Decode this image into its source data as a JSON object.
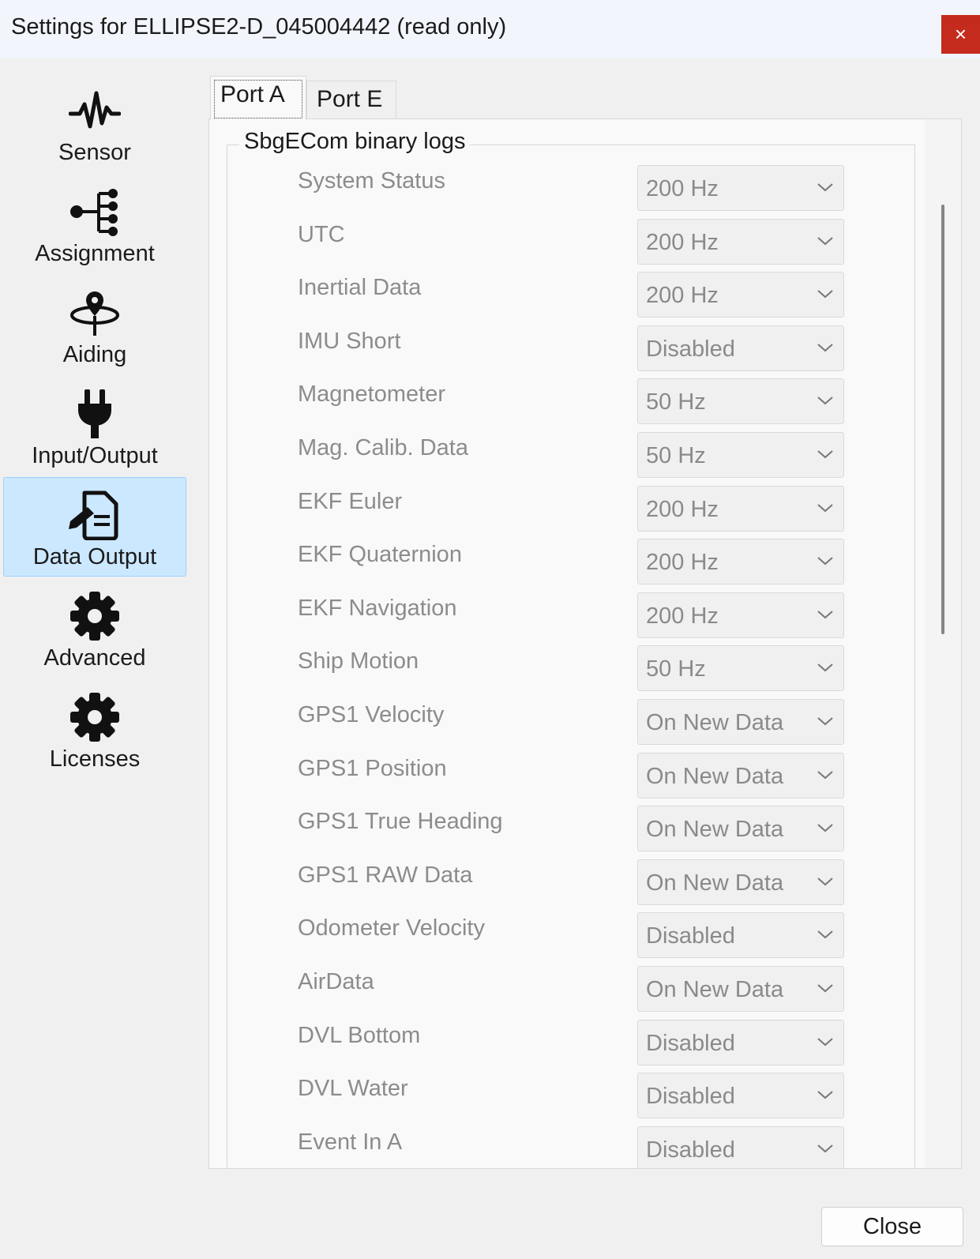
{
  "window": {
    "title": "Settings for ELLIPSE2-D_045004442 (read only)",
    "close_glyph": "×"
  },
  "sidebar": {
    "items": [
      {
        "label": "Sensor",
        "icon": "waveform-icon",
        "selected": false
      },
      {
        "label": "Assignment",
        "icon": "tree-icon",
        "selected": false
      },
      {
        "label": "Aiding",
        "icon": "pin-orbit-icon",
        "selected": false
      },
      {
        "label": "Input/Output",
        "icon": "plug-icon",
        "selected": false
      },
      {
        "label": "Data Output",
        "icon": "document-edit-icon",
        "selected": true
      },
      {
        "label": "Advanced",
        "icon": "gear-icon",
        "selected": false
      },
      {
        "label": "Licenses",
        "icon": "gear-icon",
        "selected": false
      }
    ]
  },
  "tabs": [
    {
      "label": "Port A",
      "active": true
    },
    {
      "label": "Port E",
      "active": false
    }
  ],
  "group": {
    "title": "SbgECom binary logs",
    "rows": [
      {
        "label": "System Status",
        "value": "200 Hz"
      },
      {
        "label": "UTC",
        "value": "200 Hz"
      },
      {
        "label": "Inertial Data",
        "value": "200 Hz"
      },
      {
        "label": "IMU Short",
        "value": "Disabled"
      },
      {
        "label": "Magnetometer",
        "value": "50 Hz"
      },
      {
        "label": "Mag. Calib. Data",
        "value": "50 Hz"
      },
      {
        "label": "EKF Euler",
        "value": "200 Hz"
      },
      {
        "label": "EKF Quaternion",
        "value": "200 Hz"
      },
      {
        "label": "EKF Navigation",
        "value": "200 Hz"
      },
      {
        "label": "Ship Motion",
        "value": "50 Hz"
      },
      {
        "label": "GPS1 Velocity",
        "value": "On New Data"
      },
      {
        "label": "GPS1 Position",
        "value": "On New Data"
      },
      {
        "label": "GPS1 True Heading",
        "value": "On New Data"
      },
      {
        "label": "GPS1 RAW Data",
        "value": "On New Data"
      },
      {
        "label": "Odometer Velocity",
        "value": "Disabled"
      },
      {
        "label": "AirData",
        "value": "On New Data"
      },
      {
        "label": "DVL Bottom",
        "value": "Disabled"
      },
      {
        "label": "DVL Water",
        "value": "Disabled"
      },
      {
        "label": "Event In A",
        "value": "Disabled"
      }
    ]
  },
  "footer": {
    "close_label": "Close"
  },
  "colors": {
    "selection_bg": "#cce8ff",
    "close_x_bg": "#c42b1c",
    "disabled_text": "#8c8c8c"
  }
}
